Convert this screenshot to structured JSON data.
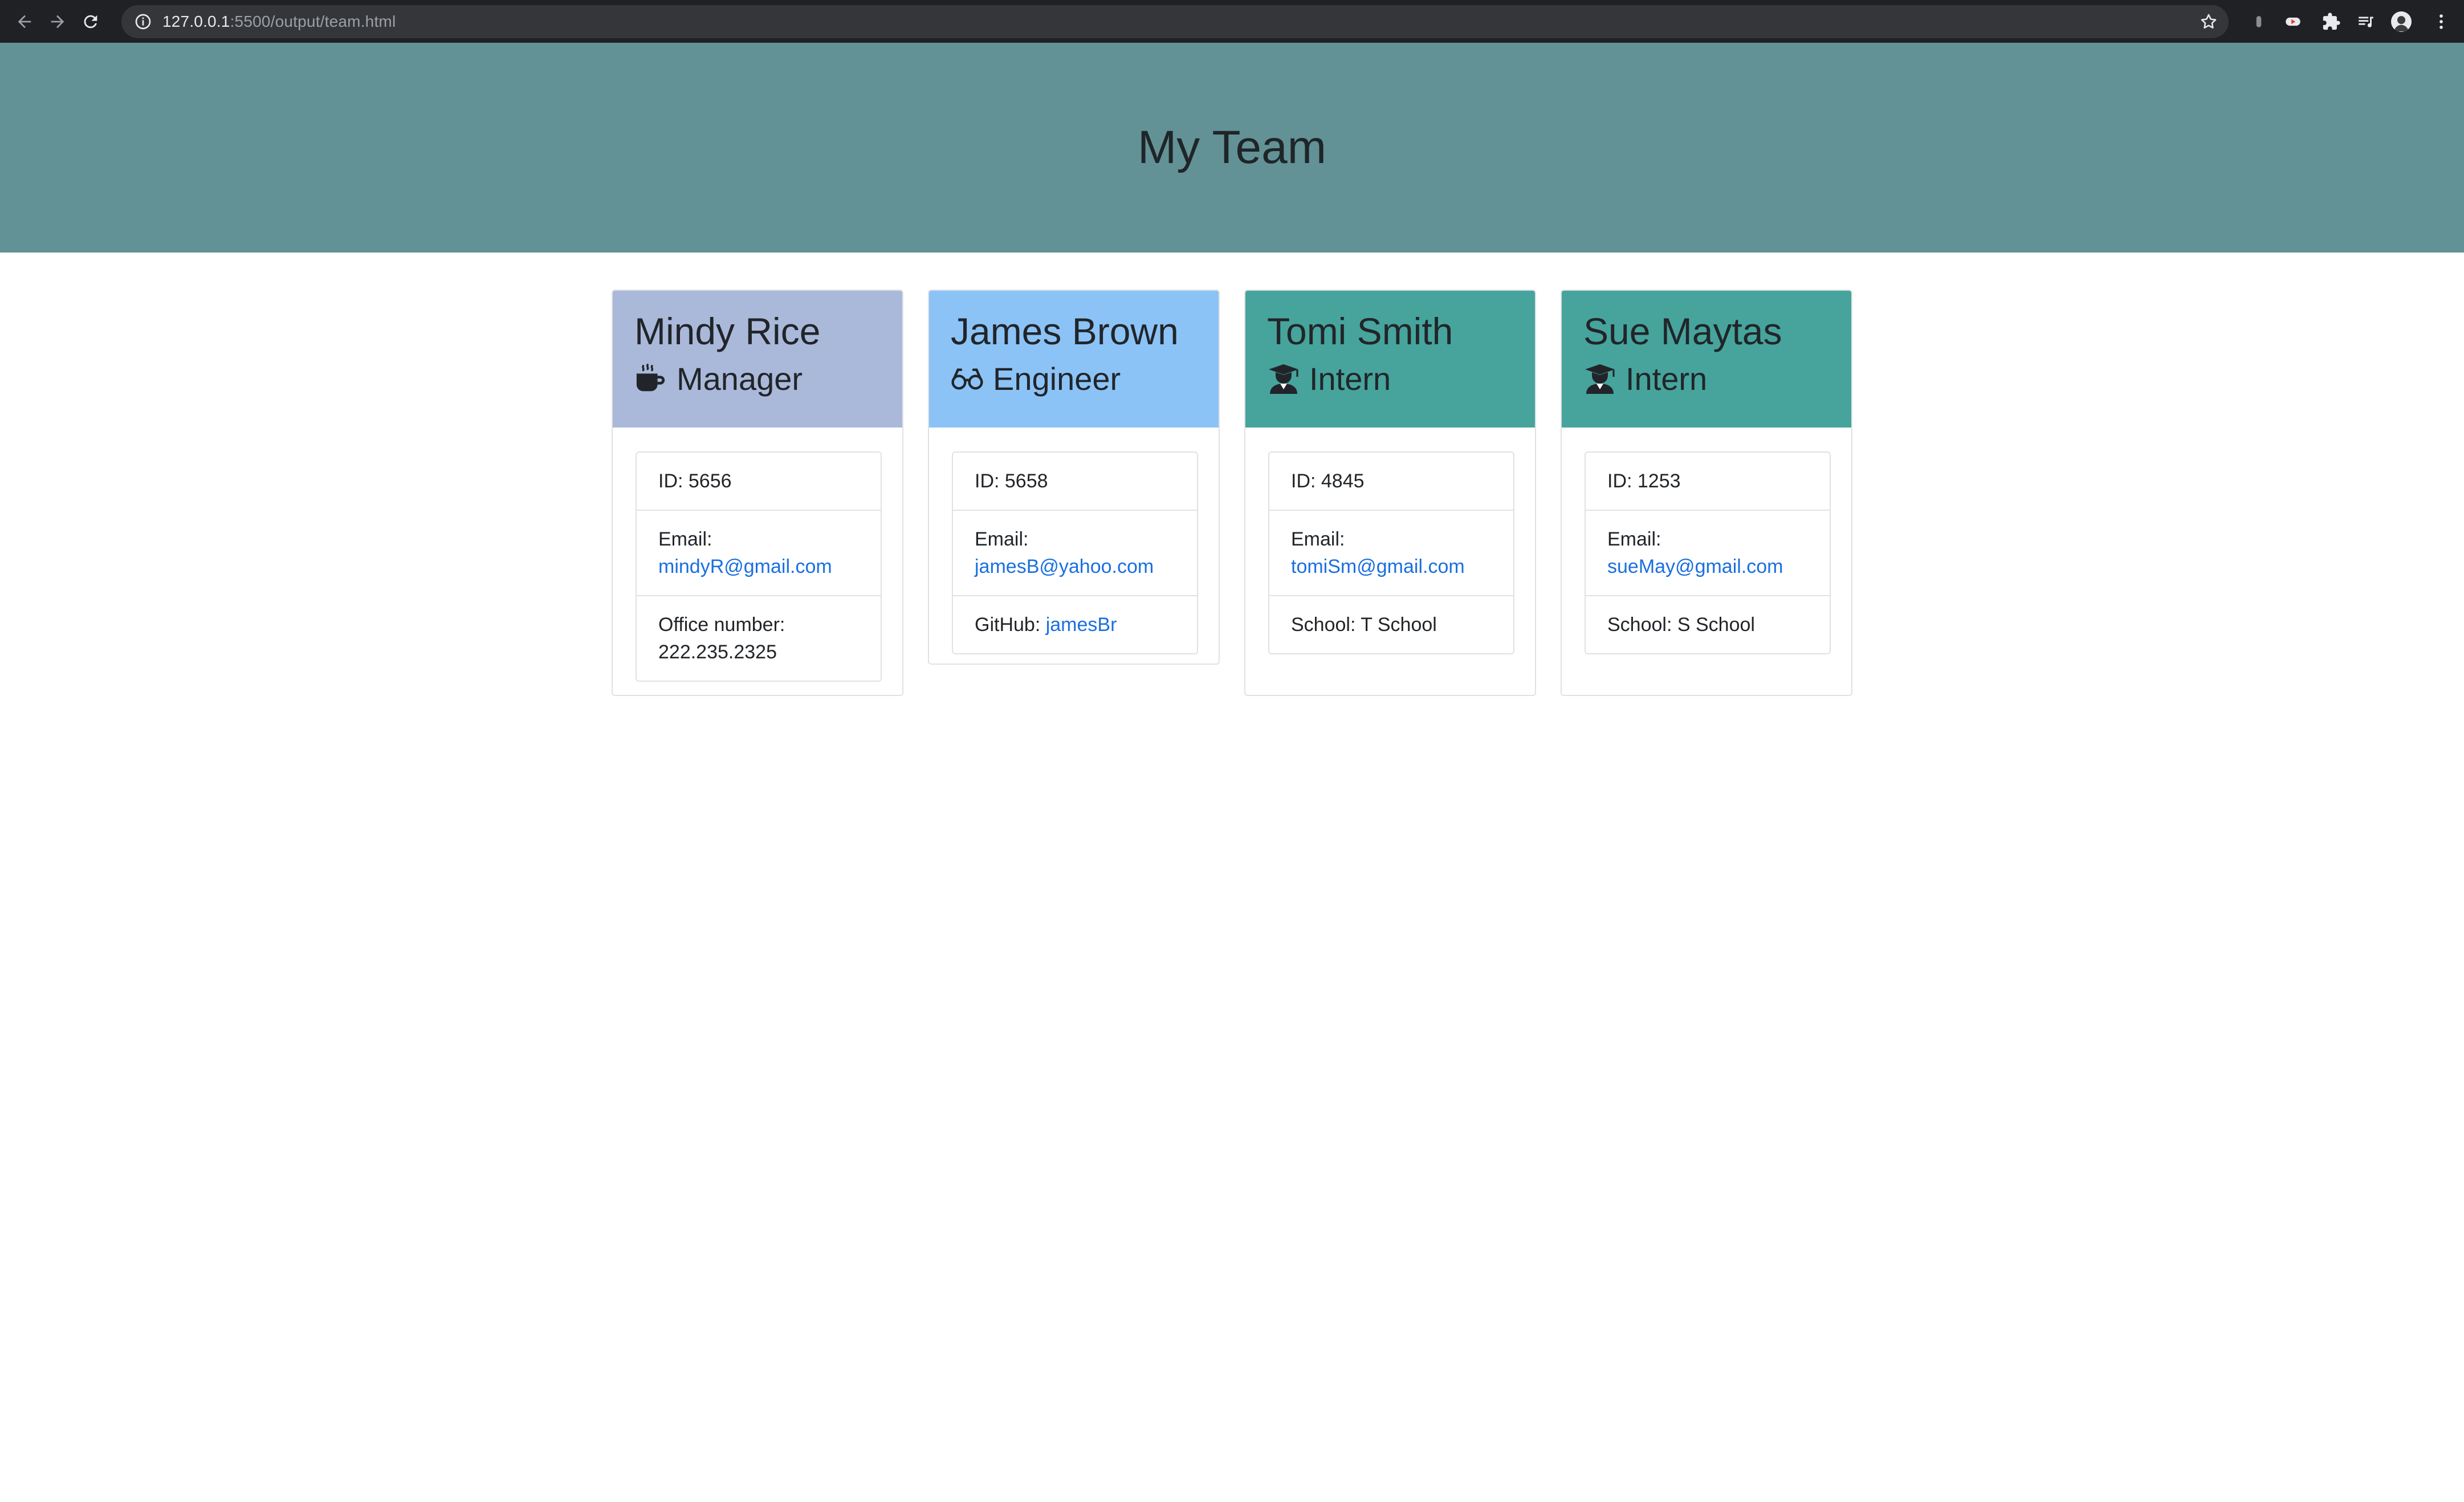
{
  "browser": {
    "url_host": "127.0.0.1",
    "url_rest": ":5500/output/team.html"
  },
  "header": {
    "title": "My Team"
  },
  "team": [
    {
      "name": "Mindy Rice",
      "role": "Manager",
      "role_icon": "coffee-mug-icon",
      "header_color": "#aab9da",
      "id_text": "ID: 5656",
      "email_label": "Email:",
      "email": "mindyR@gmail.com",
      "extra_label": "Office number:",
      "extra_value": "222.235.2325"
    },
    {
      "name": "James Brown",
      "role": "Engineer",
      "role_icon": "glasses-icon",
      "header_color": "#8cc3f7",
      "id_text": "ID: 5658",
      "email_label": "Email:",
      "email": "jamesB@yahoo.com",
      "extra_label": "GitHub:",
      "extra_value": "jamesBr"
    },
    {
      "name": "Tomi Smith",
      "role": "Intern",
      "role_icon": "graduate-icon",
      "header_color": "#46a49c",
      "id_text": "ID: 4845",
      "email_label": "Email:",
      "email": "tomiSm@gmail.com",
      "extra_label": "School:",
      "extra_value": "T School"
    },
    {
      "name": "Sue Maytas",
      "role": "Intern",
      "role_icon": "graduate-icon",
      "header_color": "#46a49c",
      "id_text": "ID: 1253",
      "email_label": "Email:",
      "email": "sueMay@gmail.com",
      "extra_label": "School:",
      "extra_value": "S School"
    }
  ]
}
